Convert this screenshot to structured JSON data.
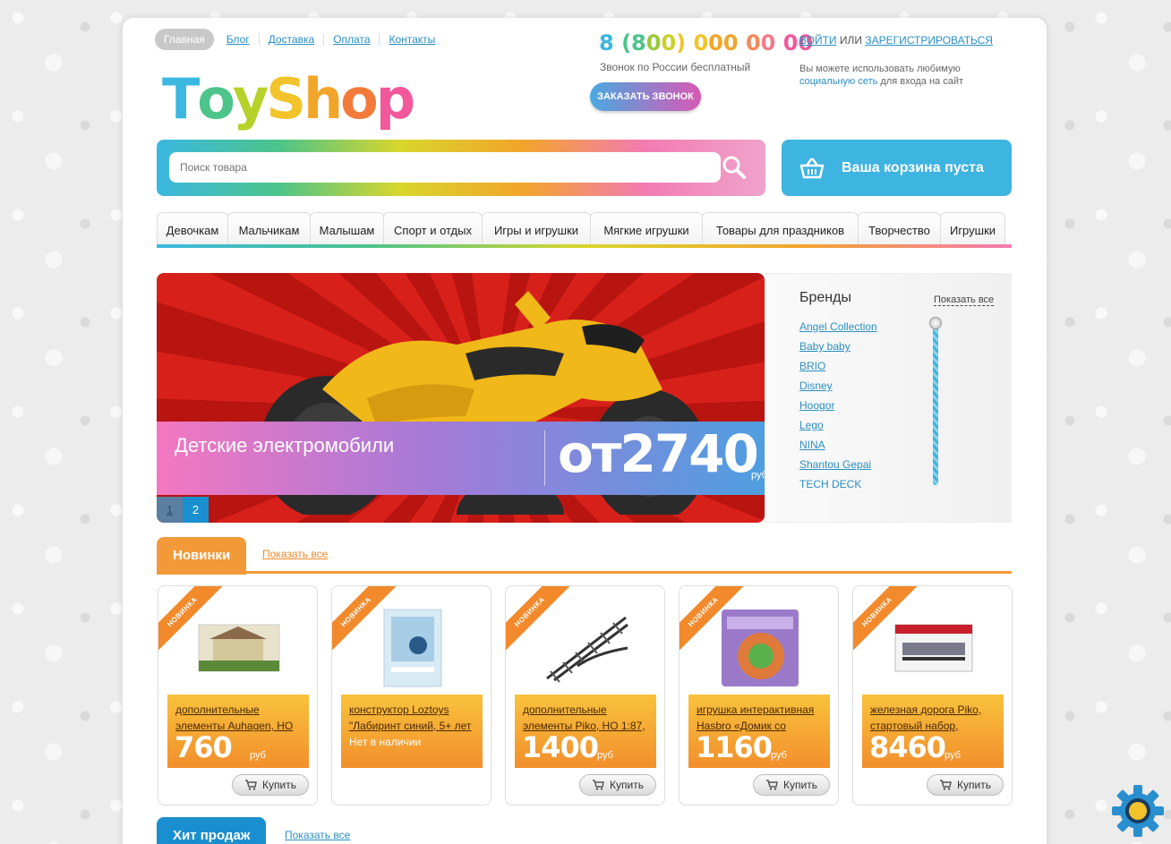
{
  "topnav": {
    "home": "Главная",
    "links": [
      "Блог",
      "Доставка",
      "Оплата",
      "Контакты"
    ]
  },
  "logo": {
    "letters": [
      "T",
      "o",
      "y",
      "S",
      "h",
      "o",
      "p"
    ],
    "colors": [
      "#3bb7e0",
      "#4cc48a",
      "#b6d12a",
      "#f2c32b",
      "#f2a52b",
      "#f27b3c",
      "#f2589a"
    ]
  },
  "phone": {
    "number": "8 (800) 000 00 00",
    "subtitle": "Звонок по России бесплатный",
    "order_button": "Заказать звонок"
  },
  "auth": {
    "login": "Войти",
    "or": "или",
    "register": "Зарегистрироваться",
    "hint_before": "Вы можете использовать любимую",
    "hint_link": "социальную сеть",
    "hint_after": "для входа на сайт"
  },
  "search": {
    "placeholder": "Поиск товара"
  },
  "cart": {
    "label": "Ваша корзина пуста"
  },
  "categories": [
    "Девочкам",
    "Мальчикам",
    "Малышам",
    "Спорт и отдых",
    "Игры и игрушки",
    "Мягкие игрушки",
    "Товары для праздников",
    "Творчество",
    "Игрушки"
  ],
  "slider": {
    "title": "Детские электромобили",
    "price": "от2740",
    "currency": "руб",
    "pages": [
      "1",
      "2"
    ],
    "active_page": 2
  },
  "brands": {
    "title": "Бренды",
    "show_all": "Показать все",
    "items": [
      "Angel Collection",
      "Baby baby",
      "BRIO",
      "Disney",
      "Hoogor",
      "Lego",
      "NINA",
      "Shantou Gepai",
      "TECH DECK"
    ]
  },
  "new_section": {
    "title": "Новинки",
    "show_all": "Показать все",
    "color": "#f29a3a"
  },
  "hits_section": {
    "title": "Хит продаж",
    "show_all": "Показать все",
    "color": "#1a8fcf"
  },
  "products": [
    {
      "badge": "НОВИНКА",
      "name": "дополнительные элементы Auhagen, HO",
      "price": "760",
      "currency": "руб",
      "buy": "Купить"
    },
    {
      "badge": "НОВИНКА",
      "name": "конструктор Loztoys \"Лабиринт синий, 5+ лет",
      "availability": "Нет в наличии"
    },
    {
      "badge": "НОВИНКА",
      "name": "дополнительные элементы Piko, HO 1:87,",
      "price": "1400",
      "currency": "руб",
      "buy": "Купить"
    },
    {
      "badge": "НОВИНКА",
      "name": "игрушка интерактивная Hasbro «Домик со",
      "price": "1160",
      "currency": "руб",
      "buy": "Купить"
    },
    {
      "badge": "НОВИНКА",
      "name": "железная дорога Piko, стартовый набор,",
      "price": "8460",
      "currency": "руб",
      "buy": "Купить"
    }
  ]
}
